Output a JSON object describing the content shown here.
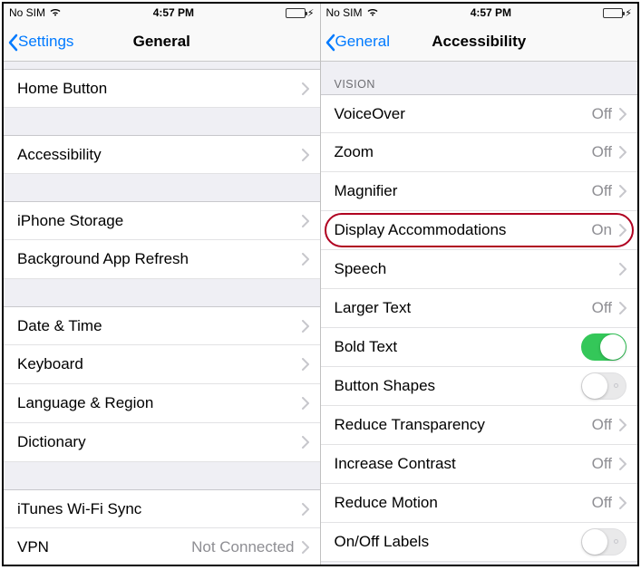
{
  "status": {
    "carrier": "No SIM",
    "time": "4:57 PM"
  },
  "left": {
    "back": "Settings",
    "title": "General",
    "groups": [
      [
        {
          "label": "Home Button",
          "disc": true
        }
      ],
      [
        {
          "label": "Accessibility",
          "disc": true
        }
      ],
      [
        {
          "label": "iPhone Storage",
          "disc": true
        },
        {
          "label": "Background App Refresh",
          "disc": true
        }
      ],
      [
        {
          "label": "Date & Time",
          "disc": true
        },
        {
          "label": "Keyboard",
          "disc": true
        },
        {
          "label": "Language & Region",
          "disc": true
        },
        {
          "label": "Dictionary",
          "disc": true
        }
      ],
      [
        {
          "label": "iTunes Wi-Fi Sync",
          "disc": true
        },
        {
          "label": "VPN",
          "value": "Not Connected",
          "disc": true
        }
      ]
    ]
  },
  "right": {
    "back": "General",
    "title": "Accessibility",
    "section_header": "VISION",
    "rows": [
      {
        "label": "VoiceOver",
        "value": "Off",
        "disc": true
      },
      {
        "label": "Zoom",
        "value": "Off",
        "disc": true
      },
      {
        "label": "Magnifier",
        "value": "Off",
        "disc": true
      },
      {
        "label": "Display Accommodations",
        "value": "On",
        "disc": true,
        "hl": true
      },
      {
        "label": "Speech",
        "disc": true
      },
      {
        "label": "Larger Text",
        "value": "Off",
        "disc": true
      },
      {
        "label": "Bold Text",
        "toggle": "on"
      },
      {
        "label": "Button Shapes",
        "toggle": "off"
      },
      {
        "label": "Reduce Transparency",
        "value": "Off",
        "disc": true
      },
      {
        "label": "Increase Contrast",
        "value": "Off",
        "disc": true
      },
      {
        "label": "Reduce Motion",
        "value": "Off",
        "disc": true
      },
      {
        "label": "On/Off Labels",
        "toggle": "off"
      }
    ]
  }
}
